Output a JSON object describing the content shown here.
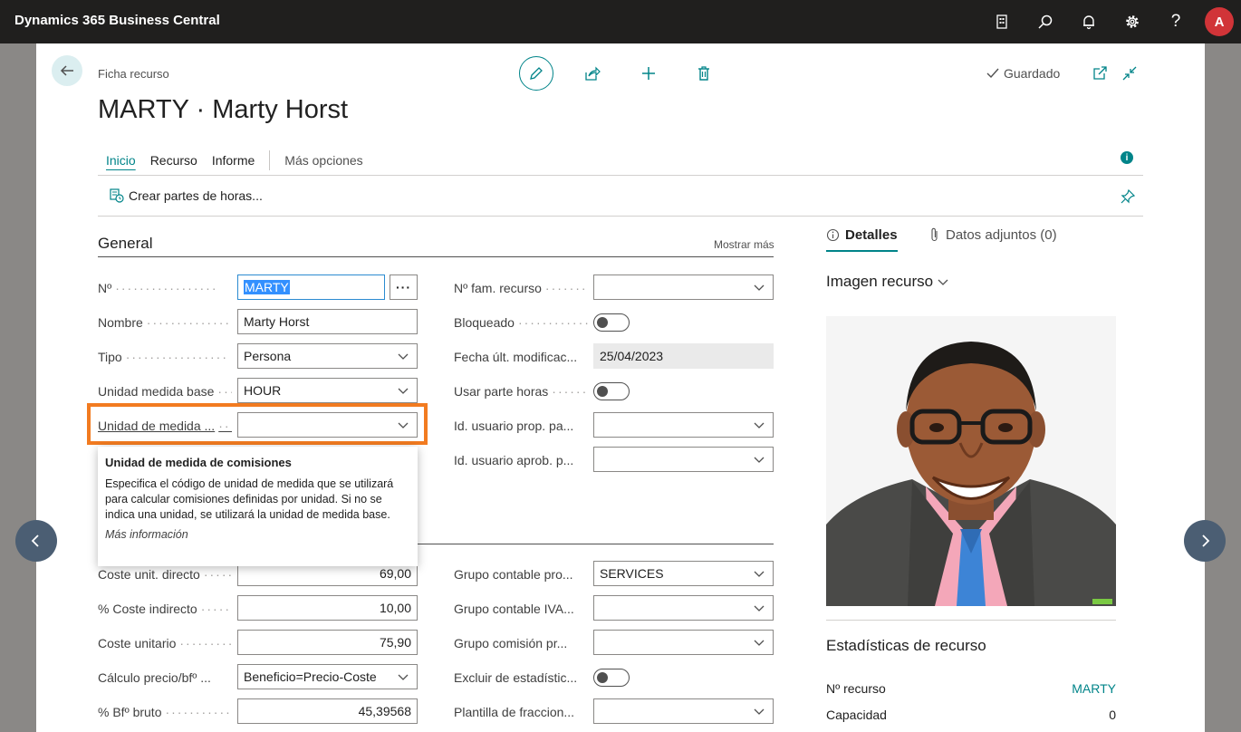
{
  "topbar": {
    "brand": "Dynamics 365 Business Central",
    "avatar_letter": "A"
  },
  "header": {
    "breadcrumb": "Ficha recurso",
    "title": "MARTY · Marty Horst",
    "saved_label": "Guardado"
  },
  "tabs": [
    {
      "label": "Inicio"
    },
    {
      "label": "Recurso"
    },
    {
      "label": "Informe"
    }
  ],
  "more_options": "Más opciones",
  "actions": {
    "create_timesheets": "Crear partes de horas..."
  },
  "general": {
    "title": "General",
    "show_more": "Mostrar más",
    "left": [
      {
        "label": "Nº",
        "value": "MARTY"
      },
      {
        "label": "Nombre",
        "value": "Marty Horst"
      },
      {
        "label": "Tipo",
        "value": "Persona"
      },
      {
        "label": "Unidad medida base",
        "value": "HOUR"
      },
      {
        "label": "Unidad de medida ...",
        "value": ""
      }
    ],
    "right": [
      {
        "label": "Nº fam. recurso",
        "value": ""
      },
      {
        "label": "Bloqueado",
        "value": ""
      },
      {
        "label": "Fecha últ. modificac...",
        "value": "25/04/2023"
      },
      {
        "label": "Usar parte horas",
        "value": ""
      },
      {
        "label": "Id. usuario prop. pa...",
        "value": ""
      },
      {
        "label": "Id. usuario aprob. p...",
        "value": ""
      }
    ]
  },
  "tooltip": {
    "title": "Unidad de medida de comisiones",
    "body": "Especifica el código de unidad de medida que se utilizará para calcular comisiones definidas por unidad. Si no se indica una unidad, se utilizará la unidad de medida base.",
    "link": "Más información"
  },
  "invoicing": {
    "left": [
      {
        "label": "Coste unit. directo",
        "value": "69,00"
      },
      {
        "label": "% Coste indirecto",
        "value": "10,00"
      },
      {
        "label": "Coste unitario",
        "value": "75,90"
      },
      {
        "label": "Cálculo precio/bfº ...",
        "value": "Beneficio=Precio-Coste"
      },
      {
        "label": "% Bfº bruto",
        "value": "45,39568"
      }
    ],
    "right": [
      {
        "label": "Grupo contable pro...",
        "value": "SERVICES"
      },
      {
        "label": "Grupo contable IVA...",
        "value": ""
      },
      {
        "label": "Grupo comisión pr...",
        "value": ""
      },
      {
        "label": "Excluir de estadístic...",
        "value": ""
      },
      {
        "label": "Plantilla de fraccion...",
        "value": ""
      }
    ]
  },
  "factbox": {
    "tab_details": "Detalles",
    "tab_attachments": "Datos adjuntos (0)",
    "image_heading": "Imagen recurso",
    "stats_heading": "Estadísticas de recurso",
    "stats": [
      {
        "label": "Nº recurso",
        "value": "MARTY"
      },
      {
        "label": "Capacidad",
        "value": "0"
      }
    ]
  },
  "colors": {
    "accent": "#008489",
    "highlight": "#f27b20",
    "topbar": "#201f1e"
  }
}
